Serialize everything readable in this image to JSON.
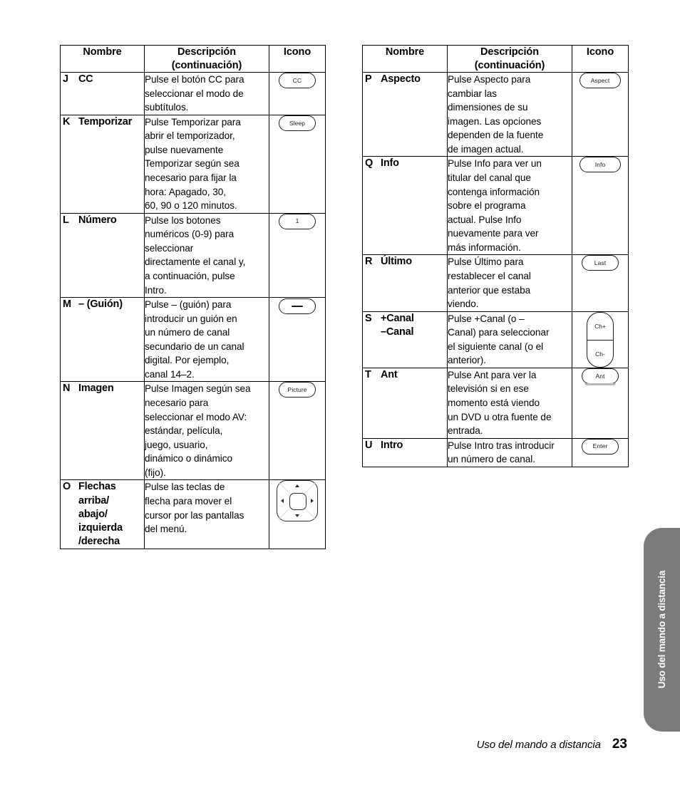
{
  "document": {
    "footer": {
      "section_title": "Uso del mando a distancia",
      "page_number": "23"
    },
    "side_tab": {
      "label": "Uso del mando a distancia",
      "color": "#7b7b7b",
      "text_color": "#ffffff"
    }
  },
  "tables": [
    {
      "id": "left-table",
      "headers": [
        "Nombre",
        "Descripción\n(continuación)",
        "Icono"
      ],
      "rows": [
        {
          "letter": "J",
          "name": "CC",
          "description": "Pulse el botón CC para\nseleccionar el modo de\nsubtítulos.",
          "icon": {
            "type": "pill",
            "label": "CC",
            "width": "pill-w50"
          }
        },
        {
          "letter": "K",
          "name": "Temporizar",
          "description": "Pulse Temporizar para\nabrir el temporizador,\npulse nuevamente\nTemporizar según sea\nnecesario para fijar la\nhora: Apagado, 30,\n60, 90 o 120 minutos.",
          "icon": {
            "type": "pill",
            "label": "Sleep",
            "width": "pill-w50"
          }
        },
        {
          "letter": "L",
          "name": "Número",
          "description": "Pulse los botones\nnuméricos (0-9) para\nseleccionar\ndirectamente el canal y,\na continuación, pulse\nIntro.",
          "icon": {
            "type": "pill",
            "label": "1",
            "width": "pill-w50"
          }
        },
        {
          "letter": "M",
          "name": "– (Guión)",
          "description": "Pulse – (guión) para\nintroducir un guión en\nun número de canal\nsecundario de un canal\ndigital. Por ejemplo,\ncanal 14–2.",
          "icon": {
            "type": "dash",
            "label": "",
            "width": "pill-w50"
          }
        },
        {
          "letter": "N",
          "name": "Imagen",
          "description": "Pulse Imagen según sea\nnecesario para\nseleccionar el modo AV:\nestándar, película,\njuego, usuario,\ndinámico o dinámico\n(fijo).",
          "icon": {
            "type": "pill",
            "label": "Picture",
            "width": "pill-w50"
          }
        },
        {
          "letter": "O",
          "name": "Flechas\narriba/\nabajo/\nizquierda\n/derecha",
          "description": "Pulse las teclas de\nflecha para mover el\ncursor por las pantallas\ndel menú.",
          "icon": {
            "type": "arrow-pad",
            "label": "",
            "width": ""
          }
        }
      ]
    },
    {
      "id": "right-table",
      "headers": [
        "Nombre",
        "Descripción\n(continuación)",
        "Icono"
      ],
      "rows": [
        {
          "letter": "P",
          "name": "Aspecto",
          "description": "Pulse Aspecto para\ncambiar las\ndimensiones de su\nimagen. Las opciones\ndependen de la fuente\nde imagen actual.",
          "icon": {
            "type": "pill",
            "label": "Aspect",
            "width": "pill-w56"
          }
        },
        {
          "letter": "Q",
          "name": "Info",
          "description": "Pulse Info para ver un\ntitular del canal que\ncontenga información\nsobre el programa\nactual. Pulse Info\nnuevamente para ver\nmás información.",
          "icon": {
            "type": "pill",
            "label": "Info",
            "width": "pill-w56"
          }
        },
        {
          "letter": "R",
          "name": "Último",
          "description": "Pulse Último para\nrestablecer el canal\nanterior que estaba\nviendo.",
          "icon": {
            "type": "pill",
            "label": "Last",
            "width": "pill-w50"
          }
        },
        {
          "letter": "S",
          "name": "+Canal\n–Canal",
          "description": "Pulse +Canal (o –\nCanal) para seleccionar\nel siguiente canal (o el\nanterior).",
          "icon": {
            "type": "rocker",
            "label_top": "Ch+",
            "label_bottom": "Ch-"
          }
        },
        {
          "letter": "T",
          "name": "Ant",
          "description": "Pulse Ant para ver la\ntelevisión si en ese\nmomento está viendo\nun DVD u otra fuente de\nentrada.",
          "icon": {
            "type": "pill-shadow",
            "label": "Ant",
            "width": "pill-w50"
          }
        },
        {
          "letter": "U",
          "name": "Intro",
          "description": "Pulse Intro tras introducir\nun número de canal.",
          "icon": {
            "type": "pill",
            "label": "Enter",
            "width": "pill-w50"
          }
        }
      ]
    }
  ]
}
